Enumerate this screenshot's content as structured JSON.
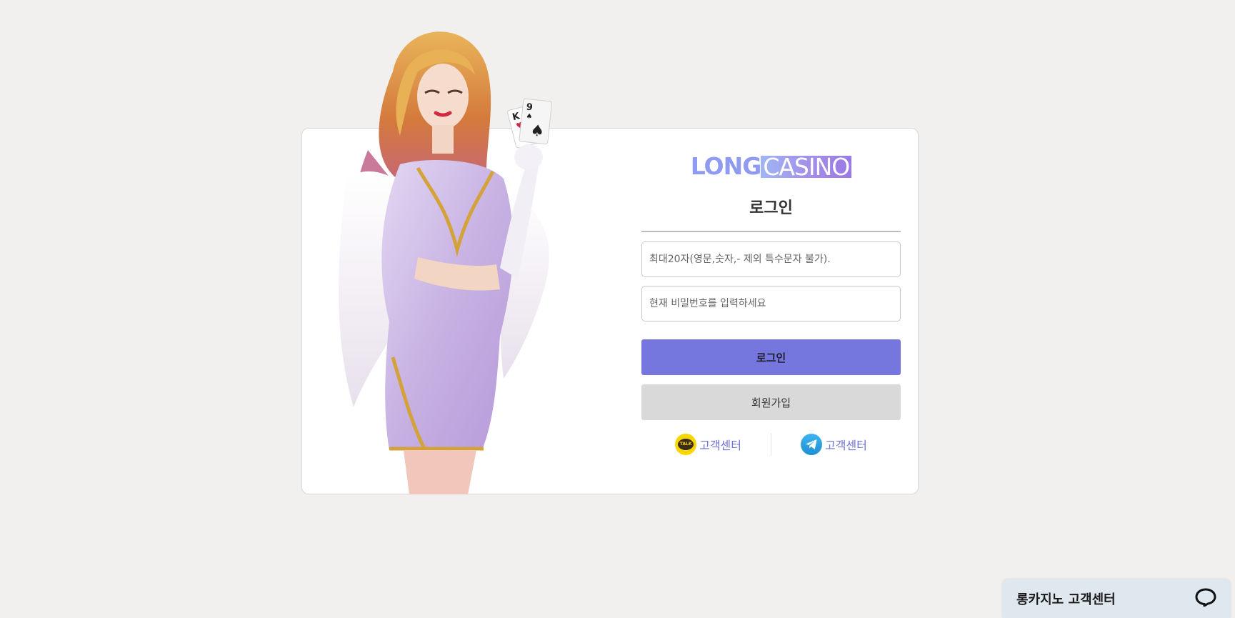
{
  "logo": {
    "part1": "LONG",
    "part2": "CASINO"
  },
  "login": {
    "title": "로그인",
    "username_placeholder": "최대20자(영문,숫자,- 제외 특수문자 불가).",
    "password_placeholder": "현재 비밀번호를 입력하세요",
    "login_button": "로그인",
    "join_button": "회원가입"
  },
  "support": [
    {
      "icon": "kakaotalk-icon",
      "label": "고객센터"
    },
    {
      "icon": "telegram-icon",
      "label": "고객센터"
    }
  ],
  "chat_widget": {
    "title": "롱카지노 고객센터",
    "icon": "chat-bubble-icon"
  },
  "colors": {
    "background": "#f1f0ee",
    "primary_button": "#7577de",
    "secondary_button": "#d9d9d9",
    "support_text": "#6e73d8",
    "chat_widget": "#dfe7ef"
  }
}
